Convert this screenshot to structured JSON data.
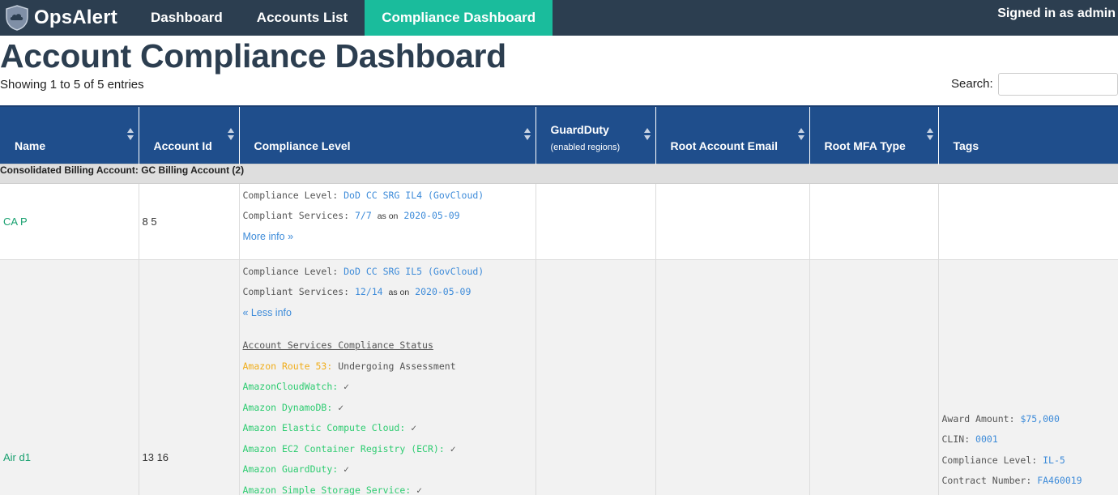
{
  "nav": {
    "brand": "OpsAlert",
    "items": [
      "Dashboard",
      "Accounts List",
      "Compliance Dashboard"
    ],
    "active_index": 2,
    "user": "Signed in as admin"
  },
  "page": {
    "title": "Account Compliance Dashboard",
    "entries_info": "Showing 1 to 5 of 5 entries",
    "search_label": "Search:",
    "search_value": ""
  },
  "table": {
    "columns": [
      {
        "label": "Name"
      },
      {
        "label": "Account Id"
      },
      {
        "label": "Compliance Level"
      },
      {
        "label": "GuardDuty",
        "sub": "(enabled regions)"
      },
      {
        "label": "Root Account Email"
      },
      {
        "label": "Root MFA Type"
      },
      {
        "label": "Tags"
      }
    ],
    "group_label": "Consolidated Billing Account: GC Billing Account (2)",
    "rows": [
      {
        "name": "CA  P",
        "account_id": "8         5",
        "compliance_level_label": "Compliance Level: ",
        "compliance_level": "DoD CC SRG IL4 (GovCloud)",
        "compliant_services_label": "Compliant Services: ",
        "compliant_services": "7/7",
        "as_on": "as on",
        "date": "2020-05-09",
        "toggle": "More info »"
      },
      {
        "name": "Air   d1",
        "account_id": "13        16",
        "compliance_level_label": "Compliance Level: ",
        "compliance_level": "DoD CC SRG IL5 (GovCloud)",
        "compliant_services_label": "Compliant Services: ",
        "compliant_services": "12/14",
        "as_on": "as on",
        "date": "2020-05-09",
        "toggle": "« Less info",
        "status_heading": "Account Services Compliance Status",
        "services": [
          {
            "name": "Amazon Route 53:",
            "value": "Undergoing Assessment",
            "status": "yellow"
          },
          {
            "name": "AmazonCloudWatch:",
            "value": "✓",
            "status": "green"
          },
          {
            "name": "Amazon DynamoDB:",
            "value": "✓",
            "status": "green"
          },
          {
            "name": "Amazon Elastic Compute Cloud:",
            "value": "✓",
            "status": "green"
          },
          {
            "name": "Amazon EC2 Container Registry (ECR):",
            "value": "✓",
            "status": "green"
          },
          {
            "name": "Amazon GuardDuty:",
            "value": "✓",
            "status": "green"
          },
          {
            "name": "Amazon Simple Storage Service:",
            "value": "✓",
            "status": "green"
          }
        ],
        "tags": [
          {
            "key": "Award Amount: ",
            "value": "$75,000"
          },
          {
            "key": "CLIN: ",
            "value": "0001"
          },
          {
            "key": "Compliance Level: ",
            "value": "IL-5"
          },
          {
            "key": "Contract Number: ",
            "value": "FA460019"
          }
        ]
      }
    ]
  },
  "colors": {
    "navbar_bg": "#2c3e50",
    "nav_active_bg": "#1abc9c",
    "table_header_bg": "#1f4e8c",
    "link_green": "#18a06f",
    "link_blue": "#3d8bd9",
    "status_yellow": "#f0ad1b",
    "status_green": "#2ecc71"
  }
}
